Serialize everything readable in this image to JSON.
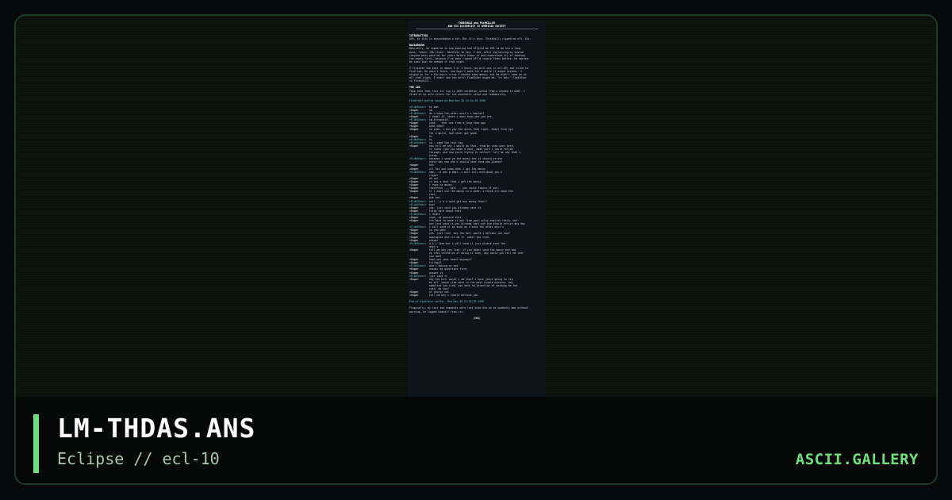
{
  "artwork": {
    "heading_1": "THRESHOLD aka PALMKILLER",
    "heading_2": "AND HIS DISSERVICE TO AMERICAN SOCIETY",
    "intro_heading": "INTRODUCTION",
    "intro_text": "Ohh, so this is exacerbated a bit. But it's true. Threshkill ripped me off. Sir.",
    "background_heading": "BACKGROUND",
    "background_lines": [
      "Basically, he roped me in one evening and offered me $25 to do him a long",
      "ansi, \"about 100 lines\". Needless to say, I did, after explaining my system",
      "(anyone whos paid me for years before knows it and understood it) of sending",
      "the money first, because I've been ripped off a couple times before. He agreed.",
      "He said that he needed it that night."
    ],
    "background_lines_2": [
      "I finished the ansi in about 3 or 4 hours (bu-bril.ans in ecl-09) and tried to",
      "find him. He wasn't there, and hasn't been for a while (I asked around). I",
      "stayed on for a few hours since I needed some money, but he didn't come on at",
      "all that night. I didnt see him until FiddlHier msged me, \"hi man.\" FiddlHier",
      "is Threshkill."
    ],
    "log_heading": "THE LOG",
    "log_intro": [
      "Take note that this irc log is 100% verbatim, saved from a window in mIRC. I",
      "fixed it up with colors for the aesthetic value and readability."
    ],
    "log_start": "FiddlHier buffer saved on Mon Dec 30 21:52:39 1996",
    "log_lines": [
      [
        "<FiddlHier>",
        "hi man"
      ],
      [
        "<Sage>",
        "um."
      ],
      [
        "<FiddlHier>",
        "do u have the other ansi's i wanted?"
      ],
      [
        "<Sage>",
        "i doubt it, cause i dont know who you are."
      ],
      [
        "<FiddlHier>",
        "im threshkill"
      ],
      [
        "<Sage>",
        "yeah    that was from a long time ago"
      ],
      [
        "<Sage>",
        "what hasnt"
      ],
      [
        "<Sage>",
        "oh yeah, i did you the ansis that night, didnt find you"
      ],
      [
        "",
        "for a while, and never got paid."
      ],
      [
        "<Sage>",
        "hi."
      ],
      [
        "<FiddlHier>",
        "hi"
      ],
      [
        "<FiddlHier>",
        "so...send the rest too"
      ],
      [
        "<Sage>",
        "now tell me why i would do that. from my view over here,"
      ],
      [
        "",
        "it looks like you made a deal, made sure i could follow"
      ],
      [
        "",
        "through, and now youre trying to collect. tell me why that's"
      ],
      [
        "",
        "wrong."
      ],
      [
        "<FiddlHier>",
        "because i send ya the money and it should arrive"
      ],
      [
        "",
        "every day now and u should send them now please?"
      ],
      [
        "<Sage>",
        "heh"
      ],
      [
        "<Sage>",
        "ill let you know when i get the money"
      ],
      [
        "<FiddlHier>",
        "umm...it was a deal..i will tell everybody you a"
      ],
      [
        "",
        "ripper"
      ],
      [
        "<Sage>",
        "oh no!"
      ],
      [
        "<Sage>",
        "it was a deal that i get the money."
      ],
      [
        "<Sage>",
        "i have no money."
      ],
      [
        "<Sage>",
        "therefore ... well .. you could figure it out."
      ],
      [
        "<Sage>",
        "if i dont see the money in a week, i think ill keep the"
      ],
      [
        "",
        "rest."
      ],
      [
        "<Sage>",
        "bye now."
      ],
      [
        "<FiddlHier>",
        "well...u'n u wont get any money then!!"
      ],
      [
        "<FiddlHier>",
        "bye!"
      ],
      [
        "<Sage>",
        "yes. just said you already sent it"
      ],
      [
        "<Sage>",
        "think hard about that"
      ],
      [
        "<FiddlHier>",
        "i didnt"
      ],
      [
        "<Sage>",
        "yeah, id guessed that."
      ],
      [
        "<Sage>",
        "its hard to make it out from your sulky english there, but"
      ],
      [
        "",
        "you just said it was already sent out and should arrive any day"
      ],
      [
        "<FiddlHier>",
        "i will send it as soon as u send the other ansi's"
      ],
      [
        "<Sage>",
        "so you went"
      ],
      [
        "<Sage>",
        "yes. just lied. why the hell would i believe you now?"
      ],
      [
        "<Sage>",
        "apologize and ill do it. admit you lied."
      ],
      [
        "<Sage>",
        "answer"
      ],
      [
        "<FiddlHier>",
        "o.k i lied but i will send it just please send the"
      ],
      [
        "",
        "ansi's"
      ],
      [
        "<Sage>",
        "tell me why you lied. if you didnt send the money and had"
      ],
      [
        "",
        "no real intention of doing it soon, why would you tell me that"
      ],
      [
        "",
        "you had?"
      ],
      [
        "<Sage>",
        "what was your board anyways?"
      ],
      [
        "<Sage>",
        "trilogy?"
      ],
      [
        "<FiddlHier>",
        "who's asking or not"
      ],
      [
        "<Sage>",
        "answer my questions first."
      ],
      [
        "<Sage>",
        "answer it"
      ],
      [
        "<FiddlHier>",
        "just send it"
      ],
      [
        "<Sage>",
        "why the hell would i do that? i have youre going to rip"
      ],
      [
        "",
        "me off. youve lied once in the past couple minutes. you"
      ],
      [
        "",
        "admitted you lied. you have no intention of sending me the"
      ],
      [
        "",
        "cash, do you?"
      ],
      [
        "<Sage>",
        "of course not."
      ],
      [
        "<Sage>",
        "tell me why i should believe you."
      ]
    ],
    "log_end": "End of FiddlHier buffer  Mon Dec 30 21:52:39 1996",
    "closing": [
      "Tragically, my last two comments were lost onto him as he suddenly and without",
      "warning, he logged himself from irc."
    ],
    "end_marker": "(END)"
  },
  "footer": {
    "title": "LM-THDAS.ANS",
    "subtitle": "Eclipse // ecl-10",
    "brand": "ASCII.GALLERY"
  },
  "colors": {
    "accent": "#6ee07a",
    "background": "#07090a",
    "frame_border": "#1f3a26",
    "nick_fiddlhier": "#5ed1d1"
  }
}
